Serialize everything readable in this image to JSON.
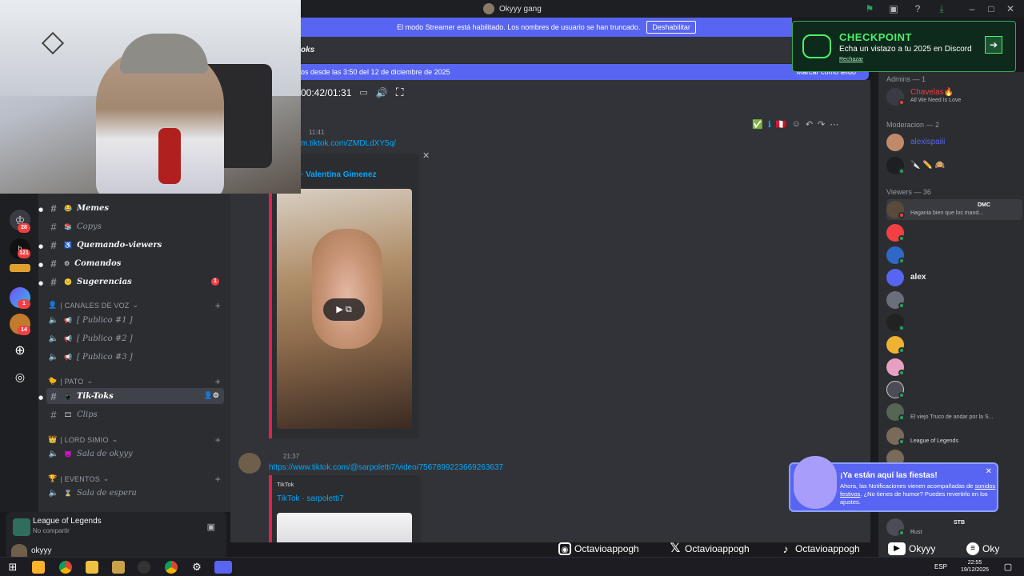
{
  "window": {
    "title": "Okyyy gang"
  },
  "streamer_bar": {
    "text": "El modo Streamer está habilitado. Los nombres de usuario se han truncado.",
    "button": "Deshabilitar"
  },
  "channel_header": {
    "name": "oks"
  },
  "new_messages": {
    "text": "os desde las 3:50 del 12 de diciembre de 2025",
    "action": "Marcar como leído"
  },
  "video": {
    "timecode": "00:42/01:31"
  },
  "messages": [
    {
      "time": "11:41",
      "link": "m.tiktok.com/ZMDLdXY5q/",
      "embed_title": "· Valentina Gimenez"
    },
    {
      "time": "21:37",
      "link": "https://www.tiktok.com/@sarpoletti7/video/7567899223669263637",
      "embed_provider": "TikTok",
      "embed_title": "TikTok · sarpoletti7"
    }
  ],
  "message_actions": [
    "✅",
    "ℹ",
    "🇵🇪",
    "☺",
    "↶",
    "↷",
    "⋯"
  ],
  "servers": [
    {
      "badge": "28"
    },
    {
      "badge": "121"
    },
    {
      "badge": ""
    },
    {
      "badge": "1"
    },
    {
      "badge": "14"
    }
  ],
  "channels": {
    "text": [
      {
        "emoji": "😂",
        "name": "Memes",
        "bold": true
      },
      {
        "emoji": "📚",
        "name": "Copys",
        "bold": false
      },
      {
        "emoji": "♿",
        "name": "Quemando-viewers",
        "bold": true
      },
      {
        "emoji": "⚙",
        "name": "Comandos",
        "bold": true
      },
      {
        "emoji": "😕",
        "name": "Sugerencias",
        "bold": true,
        "badge": "1"
      }
    ],
    "voice_category": "| CANALES DE VOZ",
    "voice": [
      {
        "emoji": "📢",
        "name": "[ Publico #1 ]"
      },
      {
        "emoji": "📢",
        "name": "[ Publico #2 ]"
      },
      {
        "emoji": "📢",
        "name": "[ Publico #3 ]"
      }
    ],
    "pato_category": "| PATO",
    "pato": [
      {
        "emoji": "📱",
        "name": "Tik-Toks",
        "selected": true
      },
      {
        "emoji": "🎞",
        "name": "Clips"
      }
    ],
    "lord_category": "| LORD SIMIO",
    "lord": [
      {
        "emoji": "😈",
        "name": "Sala de okyyy"
      }
    ],
    "events_category": "| EVENTOS",
    "events": [
      {
        "emoji": "⌛",
        "name": "Sala de espera"
      }
    ]
  },
  "activity": {
    "game": "League of Legends",
    "status": "No compartir"
  },
  "user": {
    "name": "okyyy"
  },
  "members": {
    "groups": [
      {
        "label": "Admins — 1"
      },
      {
        "label": "Moderacion — 2"
      },
      {
        "label": "Viewers — 36"
      }
    ],
    "admins": [
      {
        "name": "Chavelas🔥",
        "sub": "All We Need Is Love",
        "color": "#f23f43"
      }
    ],
    "mods": [
      {
        "name": "alexispaiii",
        "sub": "",
        "color": "#5865f2"
      },
      {
        "name": "🔪 ✏️ 🙉",
        "sub": "",
        "color": "#f23f43"
      }
    ],
    "viewers": [
      {
        "name": "",
        "sub": "Hagania bien que los mand...",
        "color": "#c0407a",
        "tag": "DMC"
      },
      {
        "name": "",
        "sub": "",
        "color": "#e2224b"
      },
      {
        "name": "",
        "sub": "",
        "color": "#c0407a"
      },
      {
        "name": "alex",
        "sub": "",
        "color": "#f2f3f5"
      },
      {
        "name": "",
        "sub": "",
        "color": "#c0407a"
      },
      {
        "name": "",
        "sub": "",
        "color": "#c0407a"
      },
      {
        "name": "",
        "sub": "",
        "color": "#e2224b"
      },
      {
        "name": "",
        "sub": "",
        "color": "#c0407a"
      },
      {
        "name": "",
        "sub": "",
        "color": "#c0407a"
      },
      {
        "name": "",
        "sub": "El viejo Truco de andar por la S...",
        "color": "#c0407a"
      },
      {
        "name": "",
        "sub": "League of Legends",
        "color": "#c0407a"
      }
    ],
    "bottom": [
      {
        "name": "",
        "sub": "Rust",
        "tag": "STB"
      }
    ]
  },
  "checkpoint": {
    "title": "CHECKPOINT",
    "subtitle": "Echa un vistazo a tu 2025 en Discord",
    "dismiss": "Rechazar"
  },
  "toast": {
    "title": "¡Ya están aquí las fiestas!",
    "body_1": "Ahora, las Notificaciones vienen acompañadas de",
    "body_link": "sonidos festivos",
    "body_2": ". ¿No tienes de humor? Puedes revertirlo en los ajustes."
  },
  "socials": [
    {
      "icon": "instagram-icon",
      "handle": "Octavioappogh"
    },
    {
      "icon": "x-icon",
      "handle": "Octavioappogh"
    },
    {
      "icon": "tiktok-icon",
      "handle": "Octavioappogh"
    },
    {
      "icon": "youtube-icon",
      "handle": "Okyyy"
    },
    {
      "icon": "twitch-icon",
      "handle": "Oky"
    }
  ],
  "taskbar": {
    "lang": "ESP",
    "time": "22:55",
    "date": "19/12/2025"
  },
  "colors": {
    "blurple": "#5865f2",
    "green": "#23a55a",
    "red": "#f23f43",
    "checkpoint_green": "#4ef06a"
  }
}
